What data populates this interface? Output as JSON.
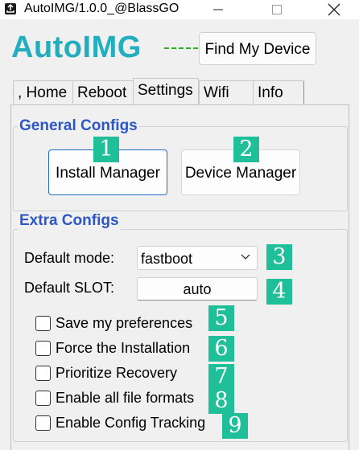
{
  "window": {
    "title": "AutoIMG/1.0.0_@BlassGO",
    "app_icon": "upload-icon",
    "controls": [
      "minimize-icon",
      "maximize-icon",
      "close-icon"
    ]
  },
  "header": {
    "brand": "AutoIMG",
    "find_button": "Find My Device",
    "brand_color": "#22aebd",
    "connector_color": "#2bb31e"
  },
  "tabs": [
    {
      "label": ", Home"
    },
    {
      "label": "Reboot"
    },
    {
      "label": "Settings",
      "active": true
    },
    {
      "label": "Wifi"
    },
    {
      "label": "Info"
    }
  ],
  "general": {
    "title": "General Configs",
    "install_button": "Install Manager",
    "device_button": "Device Manager"
  },
  "extra": {
    "title": "Extra Configs",
    "mode_label": "Default mode:",
    "mode_value": "fastboot",
    "slot_label": "Default SLOT:",
    "slot_value": "auto",
    "options": [
      {
        "label": "Save my preferences",
        "checked": false
      },
      {
        "label": "Force the Installation",
        "checked": false
      },
      {
        "label": "Prioritize Recovery",
        "checked": false
      },
      {
        "label": "Enable all file formats",
        "checked": false
      },
      {
        "label": "Enable Config Tracking",
        "checked": false
      }
    ]
  },
  "badges": [
    "1",
    "2",
    "3",
    "4",
    "5",
    "6",
    "7",
    "8",
    "9"
  ],
  "colors": {
    "group_title": "#2e57c6",
    "badge": "#1fbf9a",
    "focus_border": "#1f6fc4"
  }
}
